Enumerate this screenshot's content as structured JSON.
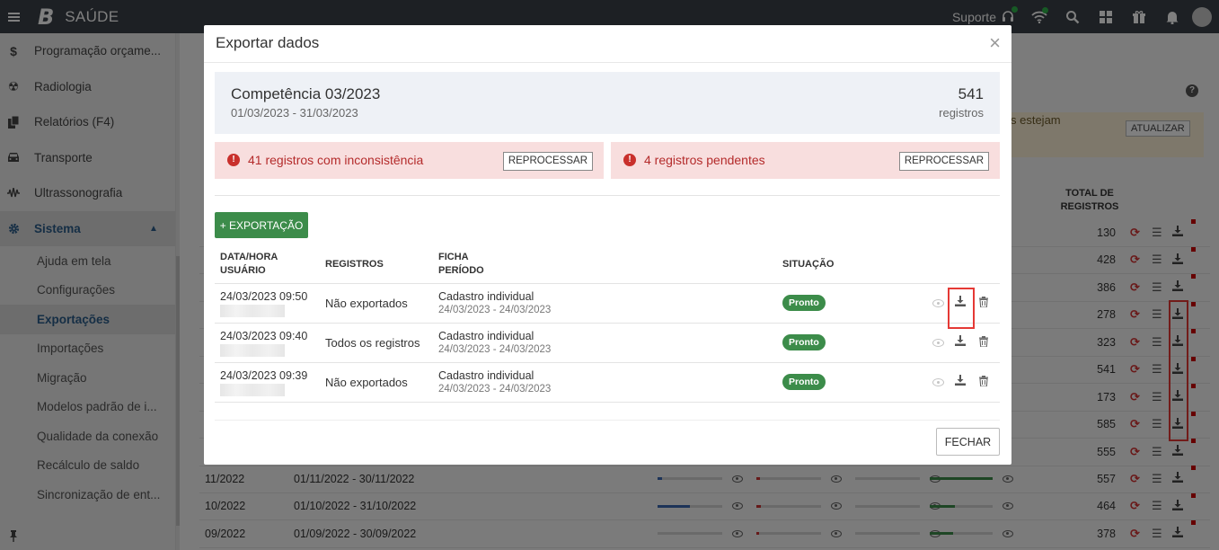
{
  "topbar": {
    "brand_logo": "B",
    "brand_name": "SAÚDE",
    "support_label": "Suporte"
  },
  "sidebar": {
    "items": [
      {
        "label": "Programação orçame...",
        "icon": "dollar-icon"
      },
      {
        "label": "Radiologia",
        "icon": "radiation-icon"
      },
      {
        "label": "Relatórios (F4)",
        "icon": "copy-icon"
      },
      {
        "label": "Transporte",
        "icon": "car-icon"
      },
      {
        "label": "Ultrassonografia",
        "icon": "waveform-icon"
      },
      {
        "label": "Sistema",
        "icon": "gear-icon"
      }
    ],
    "subitems": [
      "Ajuda em tela",
      "Configurações",
      "Exportações",
      "Importações",
      "Migração",
      "Modelos padrão de i...",
      "Qualidade da conexão",
      "Recálculo de saldo",
      "Sincronização de ent..."
    ],
    "selected_subitem": "Exportações"
  },
  "background": {
    "banner_text": "s estejam",
    "update_button": "ATUALIZAR",
    "total_header_line1": "TOTAL DE",
    "total_header_line2": "REGISTROS",
    "totals": [
      "130",
      "428",
      "386",
      "278",
      "323",
      "541",
      "173",
      "585",
      "555"
    ],
    "rows": [
      {
        "competencia": "11/2022",
        "periodo": "01/11/2022 - 30/11/2022",
        "total": "557"
      },
      {
        "competencia": "10/2022",
        "periodo": "01/10/2022 - 31/10/2022",
        "total": "464"
      },
      {
        "competencia": "09/2022",
        "periodo": "01/09/2022 - 30/09/2022",
        "total": "378"
      }
    ]
  },
  "modal": {
    "title": "Exportar dados",
    "close": "×",
    "competencia": {
      "title": "Competência 03/2023",
      "range": "01/03/2023 - 31/03/2023",
      "count": "541",
      "unit": "registros"
    },
    "alerts": [
      {
        "text": "41 registros com inconsistência",
        "button": "REPROCESSAR"
      },
      {
        "text": "4 registros pendentes",
        "button": "REPROCESSAR"
      }
    ],
    "export_button": "+ EXPORTAÇÃO",
    "table": {
      "headers": {
        "date_line1": "DATA/HORA",
        "date_line2": "USUÁRIO",
        "registros": "REGISTROS",
        "ficha_line1": "FICHA",
        "ficha_line2": "PERÍODO",
        "situacao": "SITUAÇÃO"
      },
      "rows": [
        {
          "datetime": "24/03/2023 09:50",
          "registros": "Não exportados",
          "ficha": "Cadastro individual",
          "periodo": "24/03/2023 - 24/03/2023",
          "situacao": "Pronto"
        },
        {
          "datetime": "24/03/2023 09:40",
          "registros": "Todos os registros",
          "ficha": "Cadastro individual",
          "periodo": "24/03/2023 - 24/03/2023",
          "situacao": "Pronto"
        },
        {
          "datetime": "24/03/2023 09:39",
          "registros": "Não exportados",
          "ficha": "Cadastro individual",
          "periodo": "24/03/2023 - 24/03/2023",
          "situacao": "Pronto"
        }
      ]
    },
    "close_button": "FECHAR"
  },
  "colors": {
    "topbar": "#3a4048",
    "primary_green": "#3c8c4a",
    "alert_bg": "#f8dede",
    "alert_text": "#b42b2b",
    "highlight_red": "#e53935",
    "link_blue": "#2b5d8a"
  }
}
